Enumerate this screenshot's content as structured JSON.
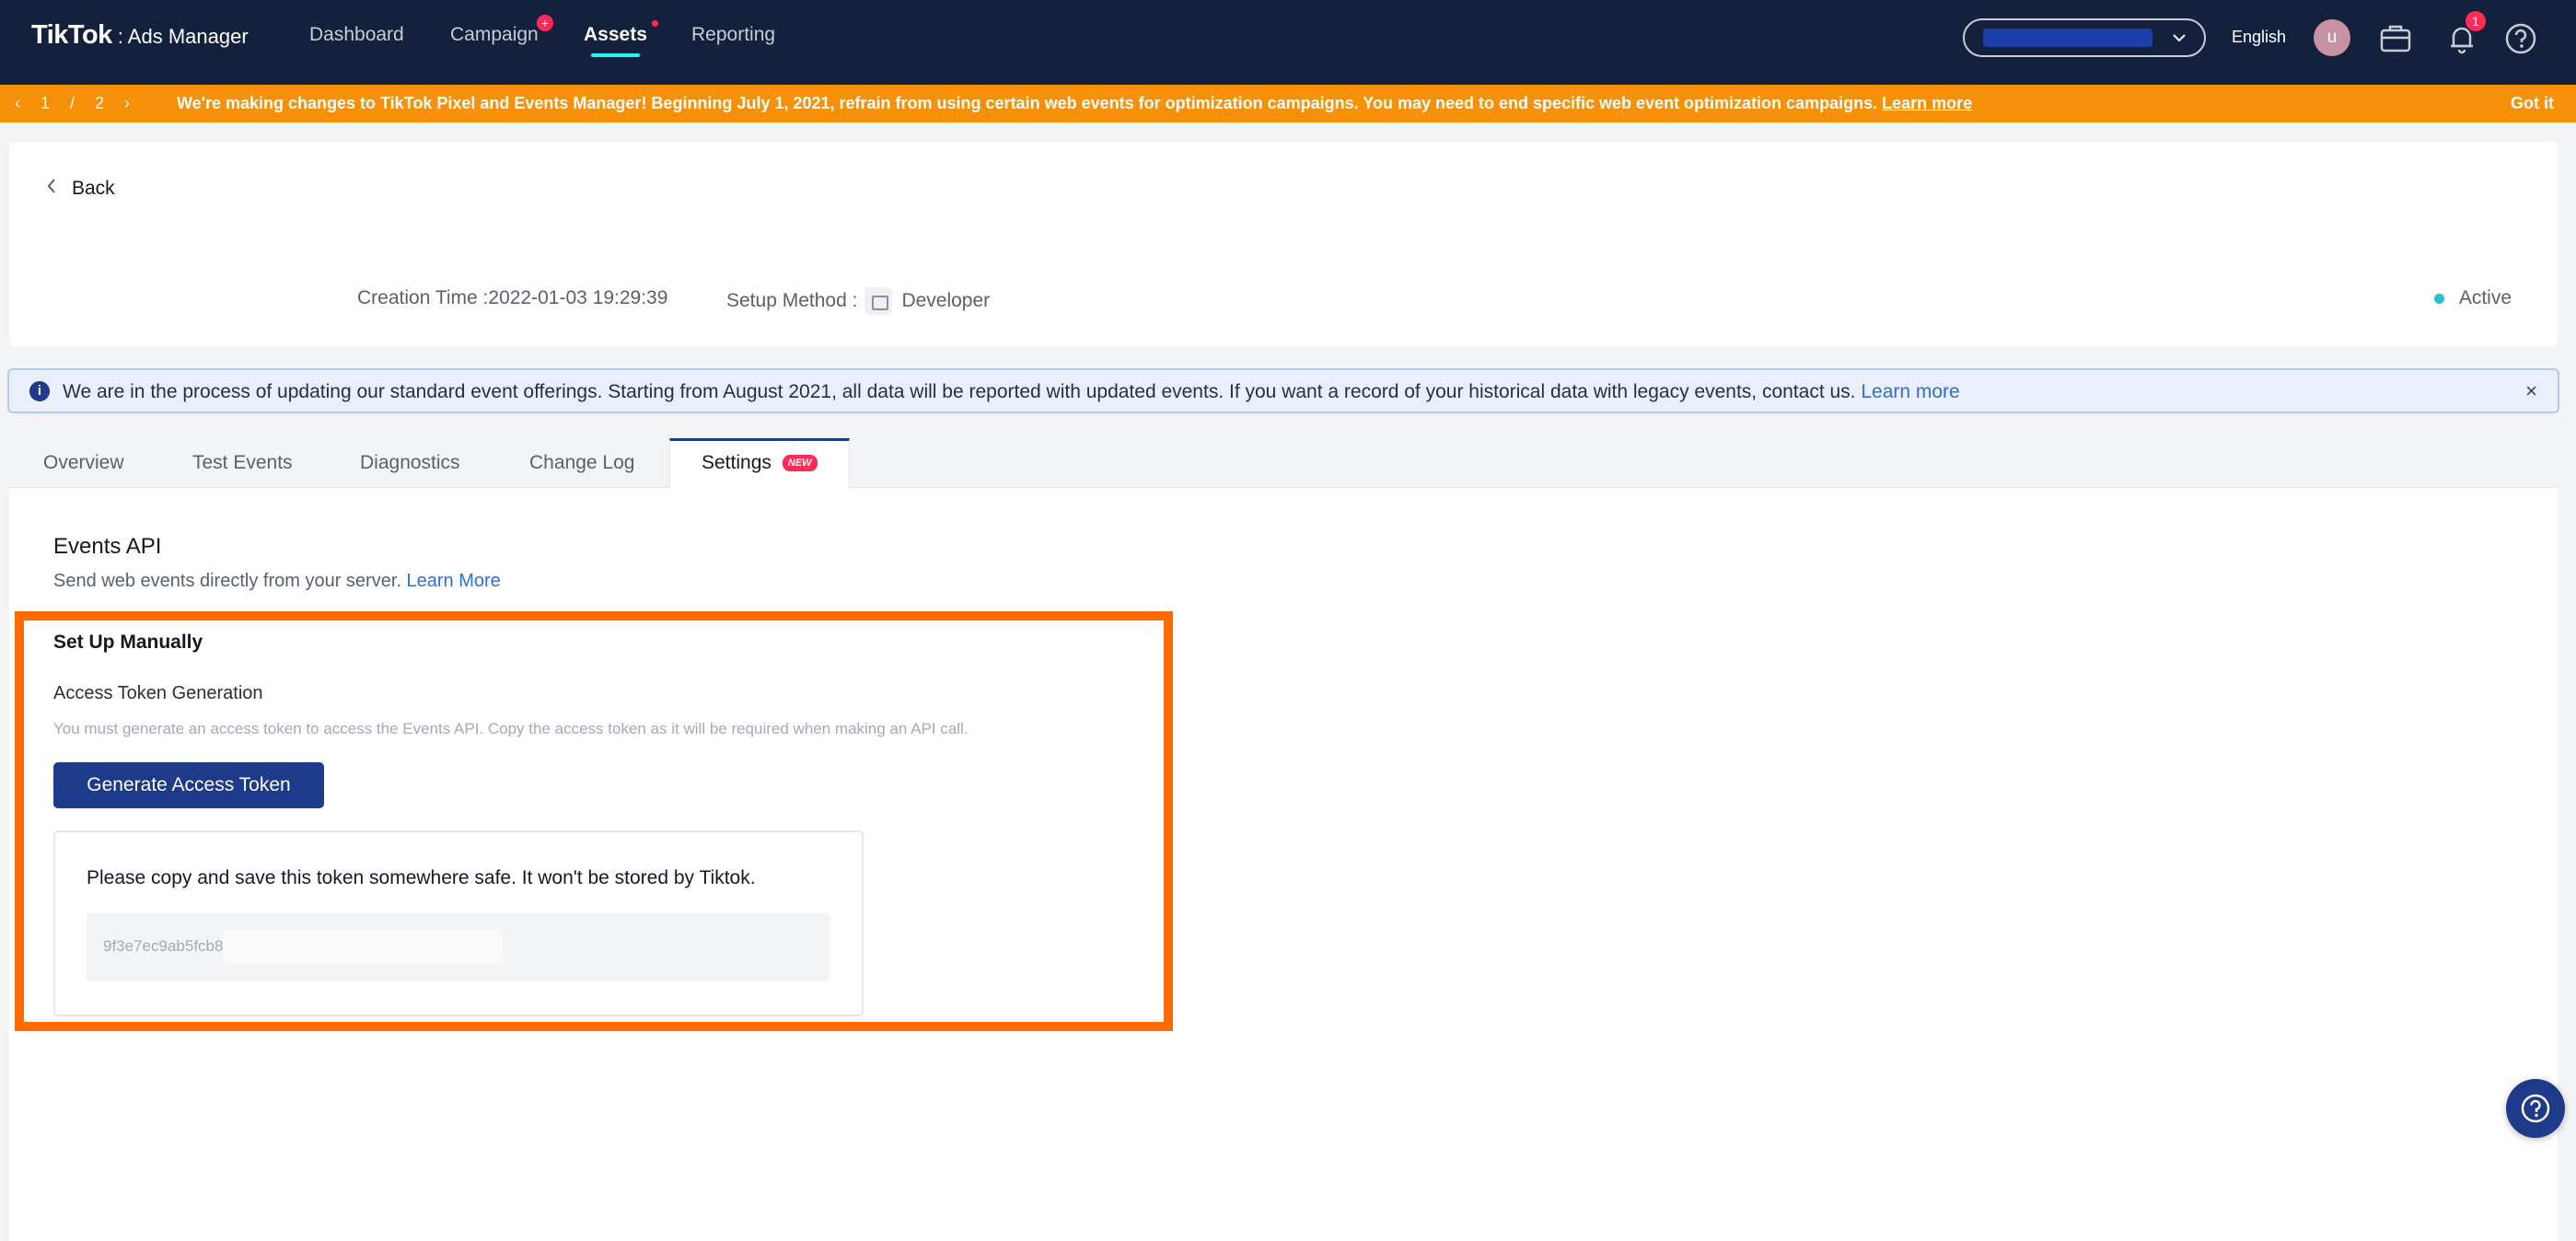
{
  "app": {
    "brand": "TikTok",
    "product": ": Ads Manager"
  },
  "nav": {
    "items": [
      "Dashboard",
      "Campaign",
      "Assets",
      "Reporting"
    ],
    "campaign_badge": "+",
    "language": "English",
    "avatar_letter": "u",
    "notification_count": "1"
  },
  "banner": {
    "page_current": "1",
    "page_sep": "/",
    "page_total": "2",
    "prefix": "We're making changes to TikTok Pixel and Events Manager! Beginning ",
    "date": "July 1, 2021",
    "suffix": ", refrain from using certain web events for optimization campaigns. You may need to end specific web event optimization campaigns. ",
    "link": "Learn more",
    "dismiss": "Got it"
  },
  "header": {
    "back": "Back",
    "creation_label": "Creation Time : ",
    "creation_value": "2022-01-03 19:29:39",
    "setup_label": "Setup Method : ",
    "setup_value": "Developer",
    "status": "Active"
  },
  "alert": {
    "text": "We are in the process of updating our standard event offerings. Starting from August 2021, all data will be reported with updated events. If you want a record of your historical data with legacy events, contact us. ",
    "link": "Learn more",
    "close": "×"
  },
  "tabs": [
    "Overview",
    "Test Events",
    "Diagnostics",
    "Change Log",
    "Settings"
  ],
  "settings_new_badge": "NEW",
  "events_api": {
    "title": "Events API",
    "desc": "Send web events directly from your server. ",
    "link": "Learn More",
    "setup_title": "Set Up Manually",
    "token_title": "Access Token Generation",
    "token_desc": "You must generate an access token to access the Events API. Copy the access token as it will be required when making an API call.",
    "button": "Generate Access Token",
    "save_msg": "Please copy and save this token somewhere safe. It won't be stored by Tiktok.",
    "token_value": "9f3e7ec9ab5fcb8"
  },
  "colors": {
    "nav_bg": "#14213d",
    "banner": "#f79009",
    "primary": "#1e3a8a",
    "highlight": "#ff6a00",
    "status_active": "#25c2cc"
  },
  "icons": [
    "chevron-left-icon",
    "chevron-right-icon",
    "chevron-down-icon",
    "briefcase-icon",
    "bell-icon",
    "help-icon",
    "info-icon",
    "close-icon",
    "code-icon"
  ]
}
